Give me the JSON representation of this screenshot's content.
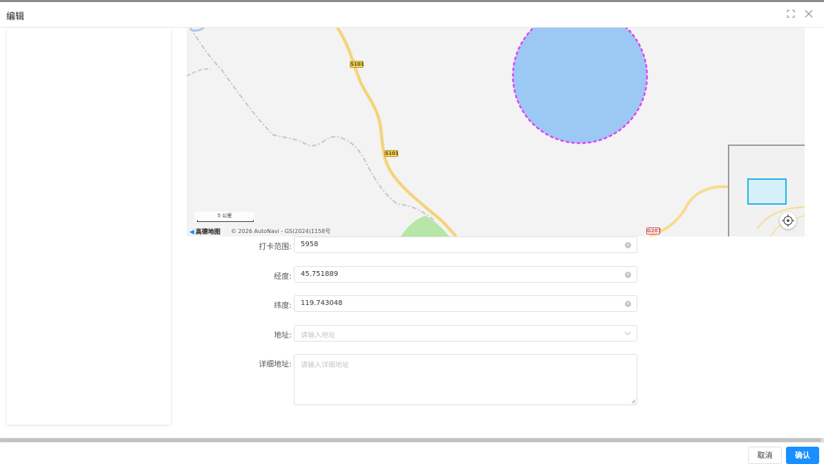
{
  "dialog": {
    "title": "编辑"
  },
  "map": {
    "road_labels": [
      "S101",
      "S101",
      "G207"
    ],
    "scale_label": "5 公里",
    "logo_text": "高德地图",
    "copyright": "© 2026 AutoNavi - GS(2024)1158号"
  },
  "form": {
    "range_label": "打卡范围:",
    "range_value": "5958",
    "longitude_label": "经度:",
    "longitude_value": "45.751889",
    "latitude_label": "纬度:",
    "latitude_value": "119.743048",
    "address_label": "地址:",
    "address_placeholder": "请输入地址",
    "detail_label": "详细地址:",
    "detail_placeholder": "请输入详细地址"
  },
  "footer": {
    "cancel_label": "取消",
    "ok_label": "确认"
  },
  "colors": {
    "primary": "#1890ff",
    "circle_fill": "#9cc8f4",
    "circle_stroke": "#e040fb"
  },
  "icons": [
    "fullscreen-icon",
    "close-icon",
    "clear-icon",
    "chevron-down-icon",
    "locate-icon",
    "amap-logo-icon"
  ]
}
